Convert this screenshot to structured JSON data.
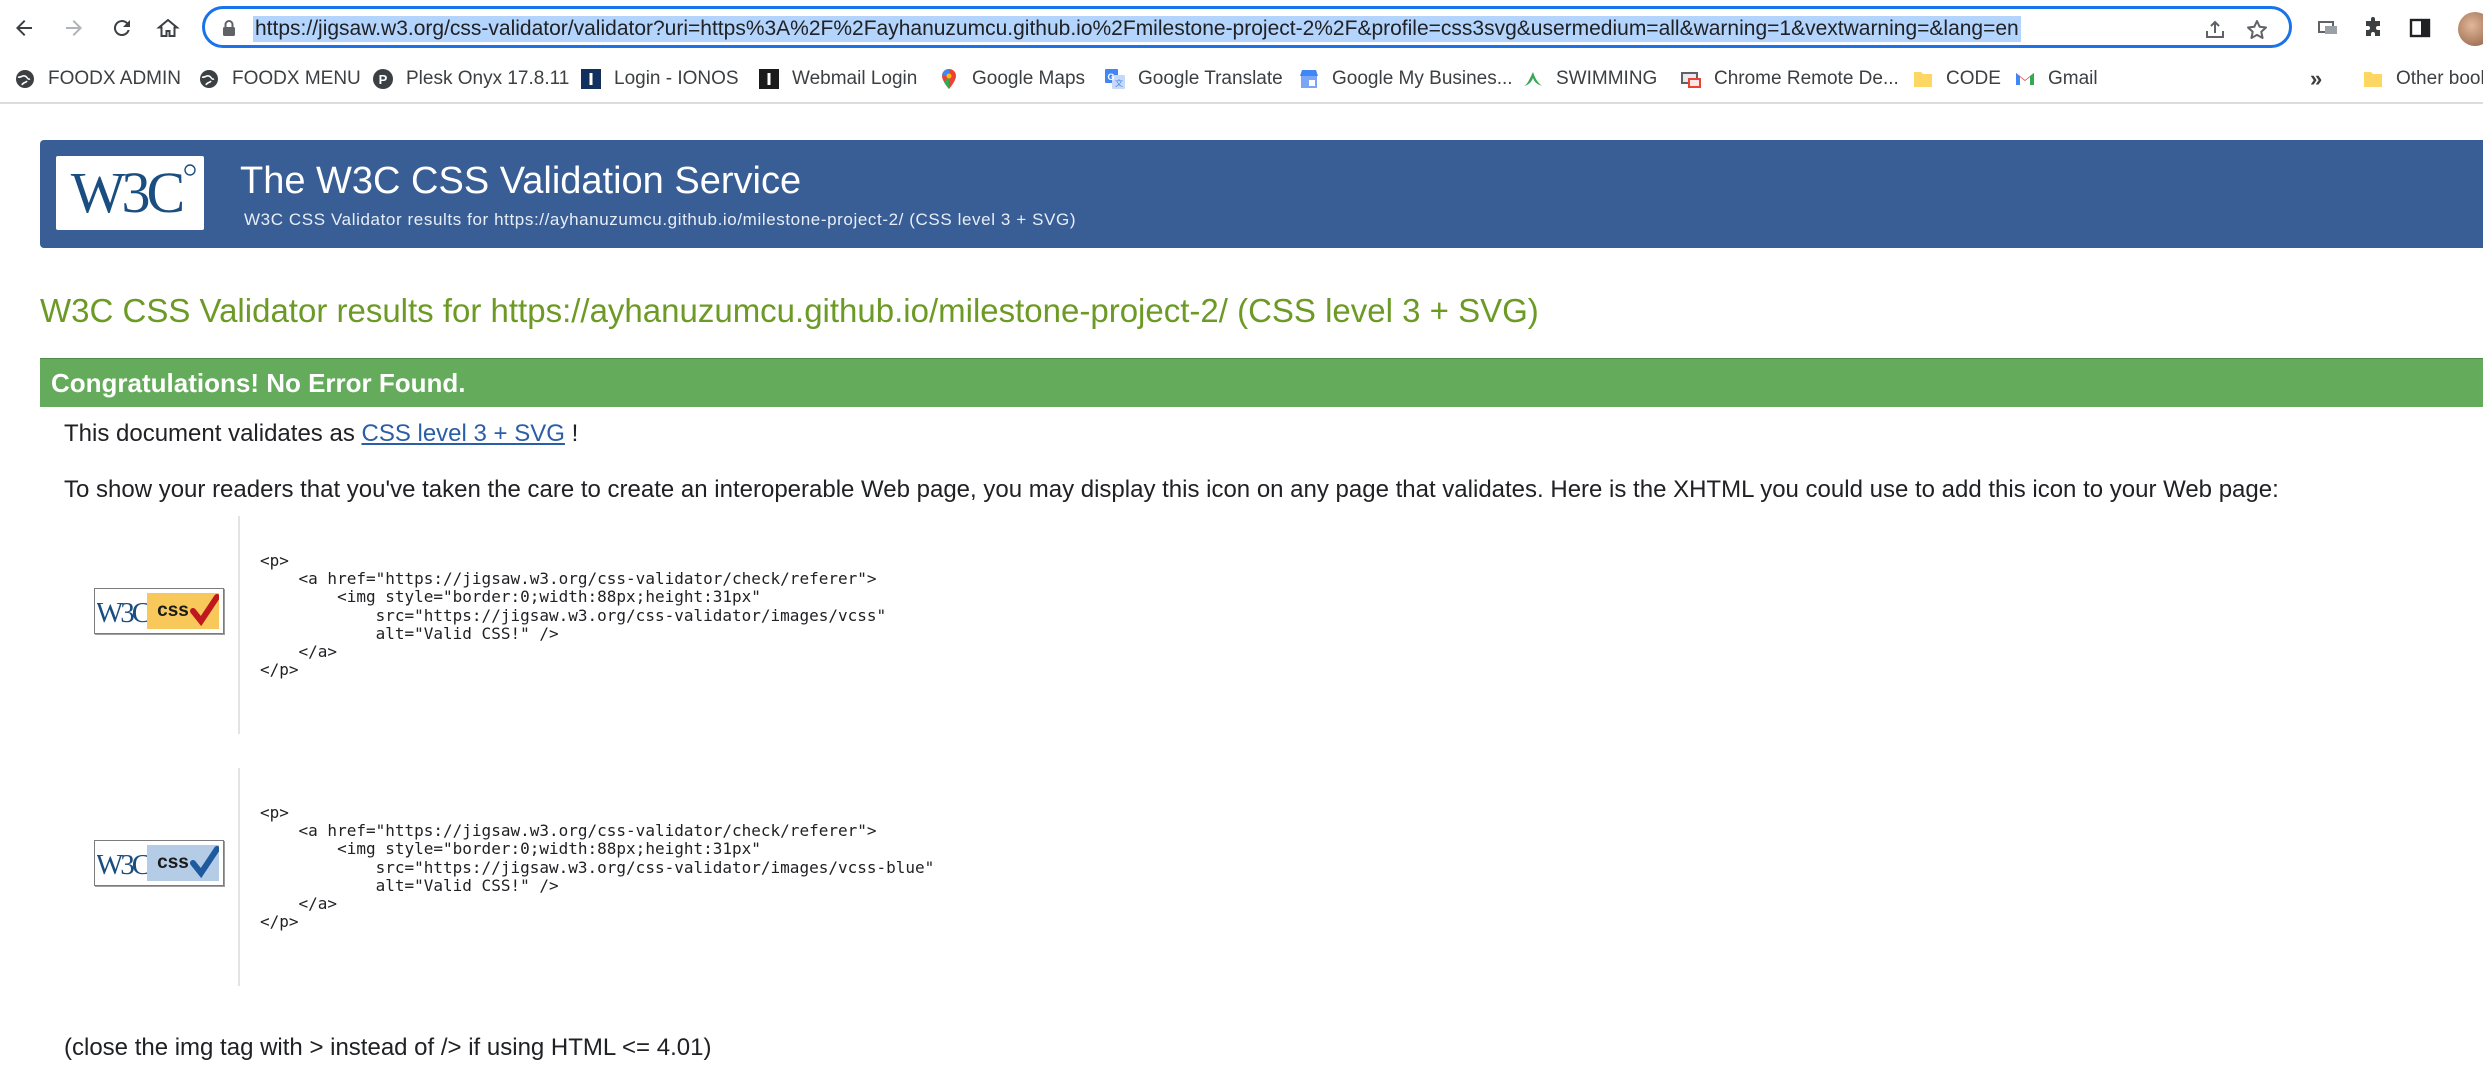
{
  "browser": {
    "url": "https://jigsaw.w3.org/css-validator/validator?uri=https%3A%2F%2Fayhanuzumcu.github.io%2Fmilestone-project-2%2F&profile=css3svg&usermedium=all&warning=1&vextwarning=&lang=en",
    "bookmarks": [
      {
        "label": "FOODX ADMIN",
        "icon": "globe-icon"
      },
      {
        "label": "FOODX MENU",
        "icon": "globe-icon"
      },
      {
        "label": "Plesk Onyx 17.8.11",
        "icon": "plesk-icon"
      },
      {
        "label": "Login - IONOS",
        "icon": "ionos-icon"
      },
      {
        "label": "Webmail Login",
        "icon": "ionos-icon"
      },
      {
        "label": "Google Maps",
        "icon": "maps-pin-icon"
      },
      {
        "label": "Google Translate",
        "icon": "translate-icon"
      },
      {
        "label": "Google My Busines...",
        "icon": "business-icon"
      },
      {
        "label": "SWIMMING",
        "icon": "leaf-icon"
      },
      {
        "label": "Chrome Remote De...",
        "icon": "remote-desktop-icon"
      },
      {
        "label": "CODE",
        "icon": "folder-icon"
      },
      {
        "label": "Gmail",
        "icon": "gmail-icon"
      }
    ],
    "bookmarks_more": "»",
    "other_bookmarks": "Other bool",
    "colors": {
      "omnibox_border": "#1a73e8",
      "url_highlight": "#b3d4fc"
    }
  },
  "banner": {
    "logo_text": "W3C",
    "title": "The W3C CSS Validation Service",
    "subtitle": "W3C CSS Validator results for https://ayhanuzumcu.github.io/milestone-project-2/ (CSS level 3 + SVG)",
    "color": "#385e95"
  },
  "main": {
    "results_title": "W3C CSS Validator results for https://ayhanuzumcu.github.io/milestone-project-2/ (CSS level 3 + SVG)",
    "congrats": "Congratulations! No Error Found.",
    "validates_prefix": "This document validates as",
    "validates_link": "CSS level 3 + SVG",
    "validates_suffix": "!",
    "show_readers": "To show your readers that you've taken the care to create an interoperable Web page, you may display this icon on any page that validates. Here is the XHTML you could use to add this icon to your Web page:",
    "badge_gold": {
      "w3c": "W3C",
      "css": "css",
      "alt": "Valid CSS!"
    },
    "badge_blue": {
      "w3c": "W3C",
      "css": "css",
      "alt": "Valid CSS!"
    },
    "code_gold": "<p>\n    <a href=\"https://jigsaw.w3.org/css-validator/check/referer\">\n        <img style=\"border:0;width:88px;height:31px\"\n            src=\"https://jigsaw.w3.org/css-validator/images/vcss\"\n            alt=\"Valid CSS!\" />\n    </a>\n</p>",
    "code_blue": "<p>\n    <a href=\"https://jigsaw.w3.org/css-validator/check/referer\">\n        <img style=\"border:0;width:88px;height:31px\"\n            src=\"https://jigsaw.w3.org/css-validator/images/vcss-blue\"\n            alt=\"Valid CSS!\" />\n    </a>\n</p>",
    "close_note": "(close the img tag with > instead of /> if using HTML <= 4.01)",
    "colors": {
      "title": "#6c9a25",
      "congrats_bg": "#64ab5b",
      "link": "#2b5ea8"
    }
  }
}
